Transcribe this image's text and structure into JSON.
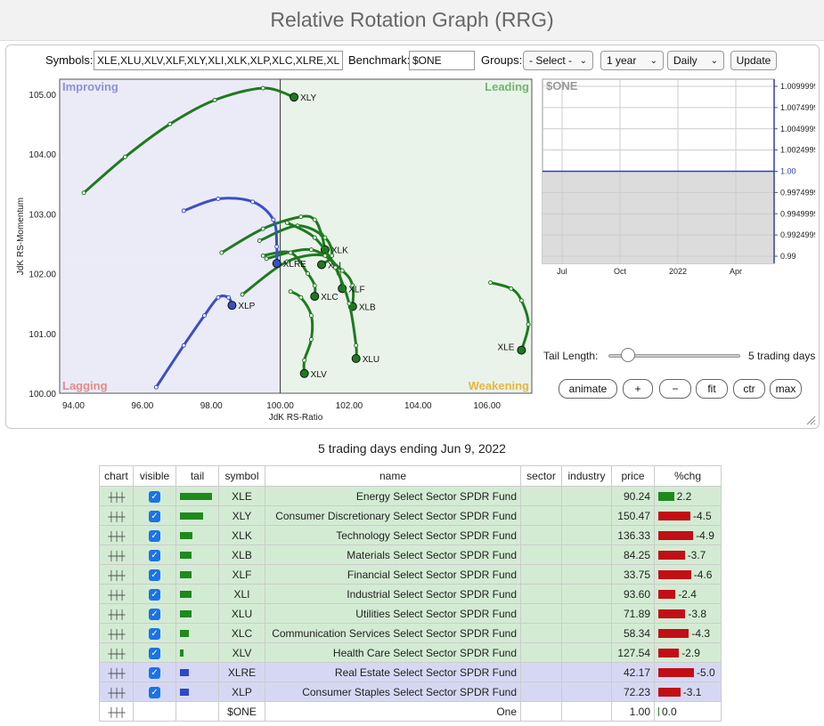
{
  "header": {
    "title": "Relative Rotation Graph (RRG)"
  },
  "controls": {
    "symbols_label": "Symbols:",
    "symbols_value": "XLE,XLU,XLV,XLF,XLY,XLI,XLK,XLP,XLC,XLRE,XLB",
    "benchmark_label": "Benchmark:",
    "benchmark_value": "$ONE",
    "groups_label": "Groups:",
    "groups_selected": "- Select -",
    "period_selected": "1 year",
    "frequency_selected": "Daily",
    "update_label": "Update"
  },
  "rrg": {
    "xlabel": "JdK RS-Ratio",
    "ylabel": "JdK RS-Momentum",
    "quadrants": {
      "improving": "Improving",
      "leading": "Leading",
      "lagging": "Lagging",
      "weakening": "Weakening"
    },
    "x_ticks": [
      "94.00",
      "96.00",
      "98.00",
      "100.00",
      "102.00",
      "104.00",
      "106.00"
    ],
    "y_ticks": [
      "105.00",
      "104.00",
      "103.00",
      "102.00",
      "101.00",
      "100.00"
    ],
    "colors": {
      "improving": "#ebebf7",
      "leading": "#eaf3ea",
      "lagging": "#ebebf7",
      "weakening": "#eaf3ea",
      "green": "#1e7a1e",
      "blue": "#3a4fc4"
    }
  },
  "benchmark_chart": {
    "symbol": "$ONE",
    "y_ticks": [
      "1.0099999",
      "1.0074999",
      "1.0049999",
      "1.0024999",
      "1.00",
      "0.9974999",
      "0.9949999",
      "0.9924999",
      "0.99"
    ],
    "x_ticks": [
      "Jul",
      "Oct",
      "2022",
      "Apr"
    ]
  },
  "tail": {
    "label": "Tail Length:",
    "value": "5 trading days",
    "fraction": 0.15
  },
  "buttons": {
    "animate": "animate",
    "plus": "+",
    "minus": "−",
    "fit": "fit",
    "ctr": "ctr",
    "max": "max"
  },
  "table": {
    "caption": "5 trading days ending Jun 9, 2022",
    "headers": [
      "chart",
      "visible",
      "tail",
      "symbol",
      "name",
      "sector",
      "industry",
      "price",
      "%chg"
    ],
    "rows": [
      {
        "symbol": "XLE",
        "name": "Energy Select Sector SPDR Fund",
        "price": "90.24",
        "chg": "2.2",
        "tail": 1.0,
        "group": "green"
      },
      {
        "symbol": "XLY",
        "name": "Consumer Discretionary Select Sector SPDR Fund",
        "price": "150.47",
        "chg": "-4.5",
        "tail": 0.72,
        "group": "green"
      },
      {
        "symbol": "XLK",
        "name": "Technology Select Sector SPDR Fund",
        "price": "136.33",
        "chg": "-4.9",
        "tail": 0.4,
        "group": "green"
      },
      {
        "symbol": "XLB",
        "name": "Materials Select Sector SPDR Fund",
        "price": "84.25",
        "chg": "-3.7",
        "tail": 0.35,
        "group": "green"
      },
      {
        "symbol": "XLF",
        "name": "Financial Select Sector SPDR Fund",
        "price": "33.75",
        "chg": "-4.6",
        "tail": 0.35,
        "group": "green"
      },
      {
        "symbol": "XLI",
        "name": "Industrial Select Sector SPDR Fund",
        "price": "93.60",
        "chg": "-2.4",
        "tail": 0.35,
        "group": "green"
      },
      {
        "symbol": "XLU",
        "name": "Utilities Select Sector SPDR Fund",
        "price": "71.89",
        "chg": "-3.8",
        "tail": 0.35,
        "group": "green"
      },
      {
        "symbol": "XLC",
        "name": "Communication Services Select Sector SPDR Fund",
        "price": "58.34",
        "chg": "-4.3",
        "tail": 0.28,
        "group": "green"
      },
      {
        "symbol": "XLV",
        "name": "Health Care Select Sector SPDR Fund",
        "price": "127.54",
        "chg": "-2.9",
        "tail": 0.1,
        "group": "green"
      },
      {
        "symbol": "XLRE",
        "name": "Real Estate Select Sector SPDR Fund",
        "price": "42.17",
        "chg": "-5.0",
        "tail": 0.28,
        "group": "blue"
      },
      {
        "symbol": "XLP",
        "name": "Consumer Staples Select Sector SPDR Fund",
        "price": "72.23",
        "chg": "-3.1",
        "tail": 0.28,
        "group": "blue"
      },
      {
        "symbol": "$ONE",
        "name": "One",
        "price": "1.00",
        "chg": "0.0",
        "tail": 0,
        "group": "none"
      }
    ]
  },
  "chart_data": {
    "type": "scatter",
    "xlabel": "JdK RS-Ratio",
    "ylabel": "JdK RS-Momentum",
    "xlim": [
      93.6,
      107.3
    ],
    "ylim": [
      100.0,
      105.25
    ],
    "series": [
      {
        "name": "XLY",
        "color": "green",
        "points": [
          [
            94.3,
            103.35
          ],
          [
            95.5,
            103.95
          ],
          [
            96.8,
            104.5
          ],
          [
            98.1,
            104.9
          ],
          [
            99.5,
            105.1
          ],
          [
            100.4,
            104.95
          ]
        ]
      },
      {
        "name": "XLE",
        "color": "green",
        "points": [
          [
            106.1,
            101.85
          ],
          [
            106.7,
            101.75
          ],
          [
            107.0,
            101.55
          ],
          [
            107.2,
            101.15
          ],
          [
            107.0,
            100.72
          ]
        ]
      },
      {
        "name": "XLK",
        "color": "green",
        "points": [
          [
            98.3,
            102.35
          ],
          [
            99.5,
            102.75
          ],
          [
            100.6,
            102.95
          ],
          [
            101.0,
            102.9
          ],
          [
            101.2,
            102.65
          ],
          [
            101.3,
            102.4
          ]
        ]
      },
      {
        "name": "XLI",
        "color": "green",
        "points": [
          [
            99.4,
            102.55
          ],
          [
            100.5,
            102.8
          ],
          [
            101.3,
            102.6
          ],
          [
            101.5,
            102.3
          ],
          [
            101.2,
            102.15
          ]
        ]
      },
      {
        "name": "XLB",
        "color": "green",
        "points": [
          [
            99.6,
            102.25
          ],
          [
            100.9,
            102.4
          ],
          [
            101.8,
            102.05
          ],
          [
            102.1,
            101.8
          ],
          [
            102.1,
            101.45
          ]
        ]
      },
      {
        "name": "XLF",
        "color": "green",
        "points": [
          [
            98.9,
            101.65
          ],
          [
            100.2,
            102.2
          ],
          [
            101.3,
            102.3
          ],
          [
            101.7,
            102.0
          ],
          [
            101.8,
            101.75
          ]
        ]
      },
      {
        "name": "XLU",
        "color": "green",
        "points": [
          [
            100.2,
            102.85
          ],
          [
            101.0,
            102.6
          ],
          [
            101.6,
            102.1
          ],
          [
            102.0,
            101.5
          ],
          [
            102.2,
            100.8
          ],
          [
            102.2,
            100.58
          ]
        ]
      },
      {
        "name": "XLC",
        "color": "green",
        "points": [
          [
            99.5,
            102.3
          ],
          [
            100.3,
            102.35
          ],
          [
            100.8,
            102.0
          ],
          [
            101.0,
            101.8
          ],
          [
            101.0,
            101.62
          ]
        ]
      },
      {
        "name": "XLV",
        "color": "green",
        "points": [
          [
            100.3,
            101.7
          ],
          [
            100.6,
            101.6
          ],
          [
            100.9,
            101.3
          ],
          [
            100.9,
            100.9
          ],
          [
            100.7,
            100.55
          ],
          [
            100.7,
            100.33
          ]
        ]
      },
      {
        "name": "XLRE",
        "color": "blue",
        "points": [
          [
            97.2,
            103.05
          ],
          [
            98.2,
            103.25
          ],
          [
            99.2,
            103.2
          ],
          [
            99.8,
            102.9
          ],
          [
            99.9,
            102.45
          ],
          [
            99.9,
            102.17
          ]
        ]
      },
      {
        "name": "XLP",
        "color": "blue",
        "points": [
          [
            96.4,
            100.1
          ],
          [
            97.2,
            100.8
          ],
          [
            97.8,
            101.3
          ],
          [
            98.2,
            101.6
          ],
          [
            98.5,
            101.6
          ],
          [
            98.6,
            101.47
          ]
        ]
      }
    ]
  }
}
